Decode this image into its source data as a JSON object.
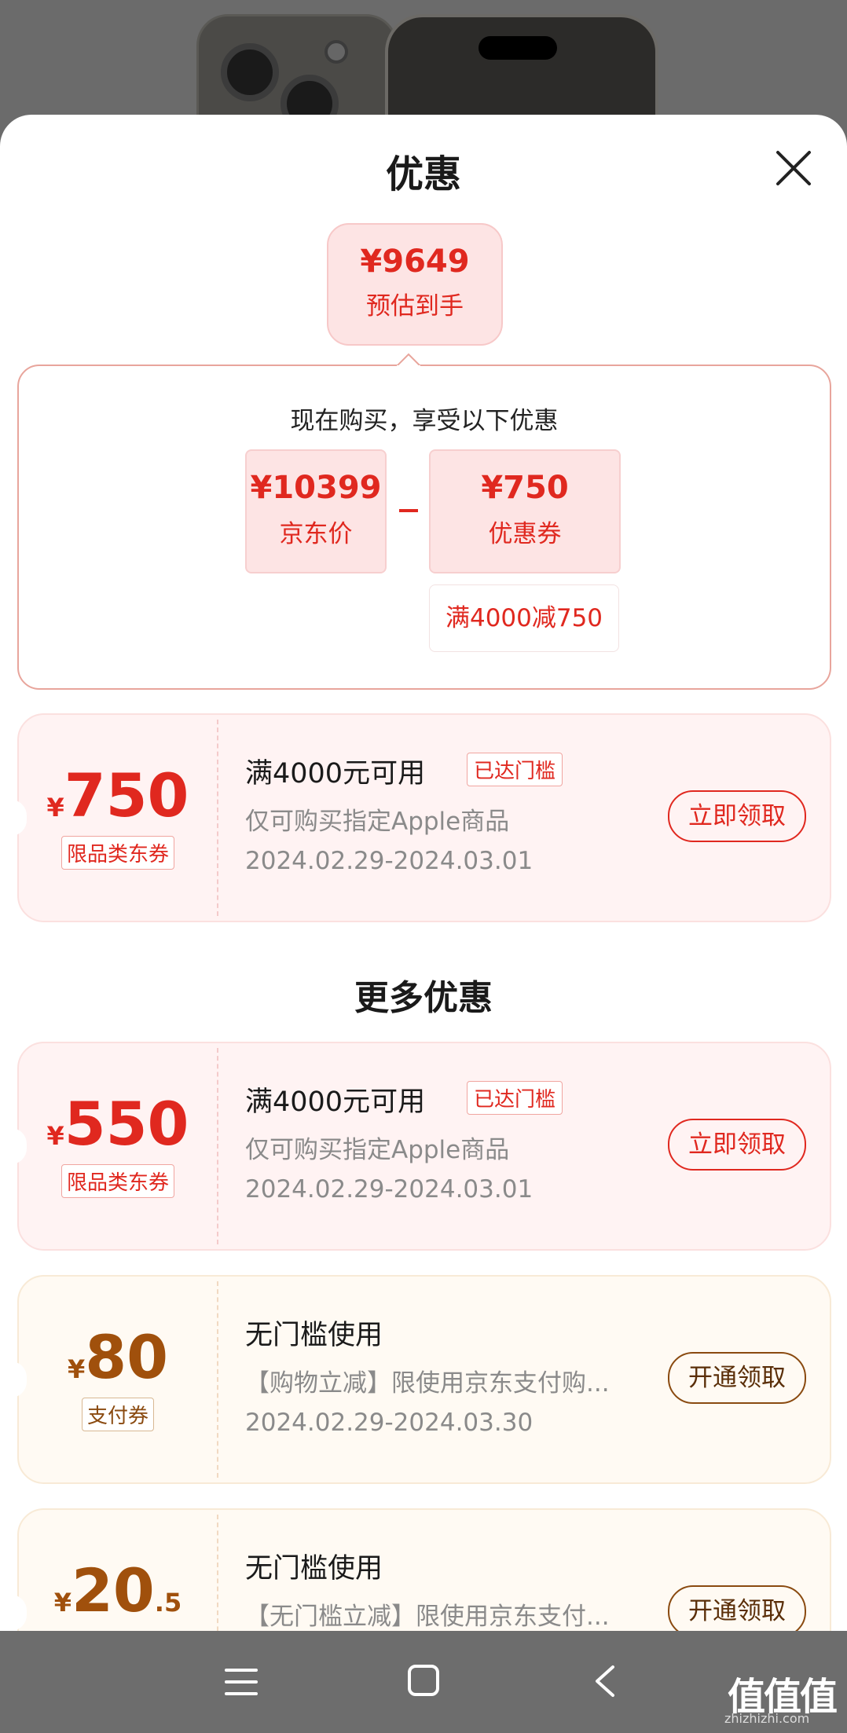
{
  "sheet": {
    "title": "优惠",
    "estimate": {
      "price": "¥9649",
      "label": "预估到手"
    },
    "detail": {
      "title": "现在购买，享受以下优惠",
      "jd_price": {
        "value": "¥10399",
        "label": "京东价"
      },
      "coupon": {
        "value": "¥750",
        "label": "优惠券",
        "condition": "满4000减750"
      }
    }
  },
  "coupons": [
    {
      "currency": "¥",
      "amount": "750",
      "type": "限品类东券",
      "title": "满4000元可用",
      "tag": "已达门槛",
      "desc": "仅可购买指定Apple商品",
      "date": "2024.02.29-2024.03.01",
      "button": "立即领取"
    }
  ],
  "more": {
    "title": "更多优惠",
    "coupons": [
      {
        "currency": "¥",
        "amount": "550",
        "type": "限品类东券",
        "title": "满4000元可用",
        "tag": "已达门槛",
        "desc": "仅可购买指定Apple商品",
        "date": "2024.02.29-2024.03.01",
        "button": "立即领取"
      },
      {
        "currency": "¥",
        "amount": "80",
        "type": "支付券",
        "title": "无门槛使用",
        "desc": "【购物立减】限使用京东支付购...",
        "date": "2024.02.29-2024.03.30",
        "button": "开通领取"
      },
      {
        "currency": "¥",
        "amount": "20",
        "decimal": ".5",
        "title": "无门槛使用",
        "desc": "【无门槛立减】限使用京东支付...",
        "button": "开通领取"
      }
    ]
  },
  "watermark": {
    "logo": "值值值",
    "url": "zhizhizhi.com"
  },
  "colors": {
    "accent": "#e0281f",
    "gold": "#a0500c",
    "overlay": "#6b6b6b"
  }
}
